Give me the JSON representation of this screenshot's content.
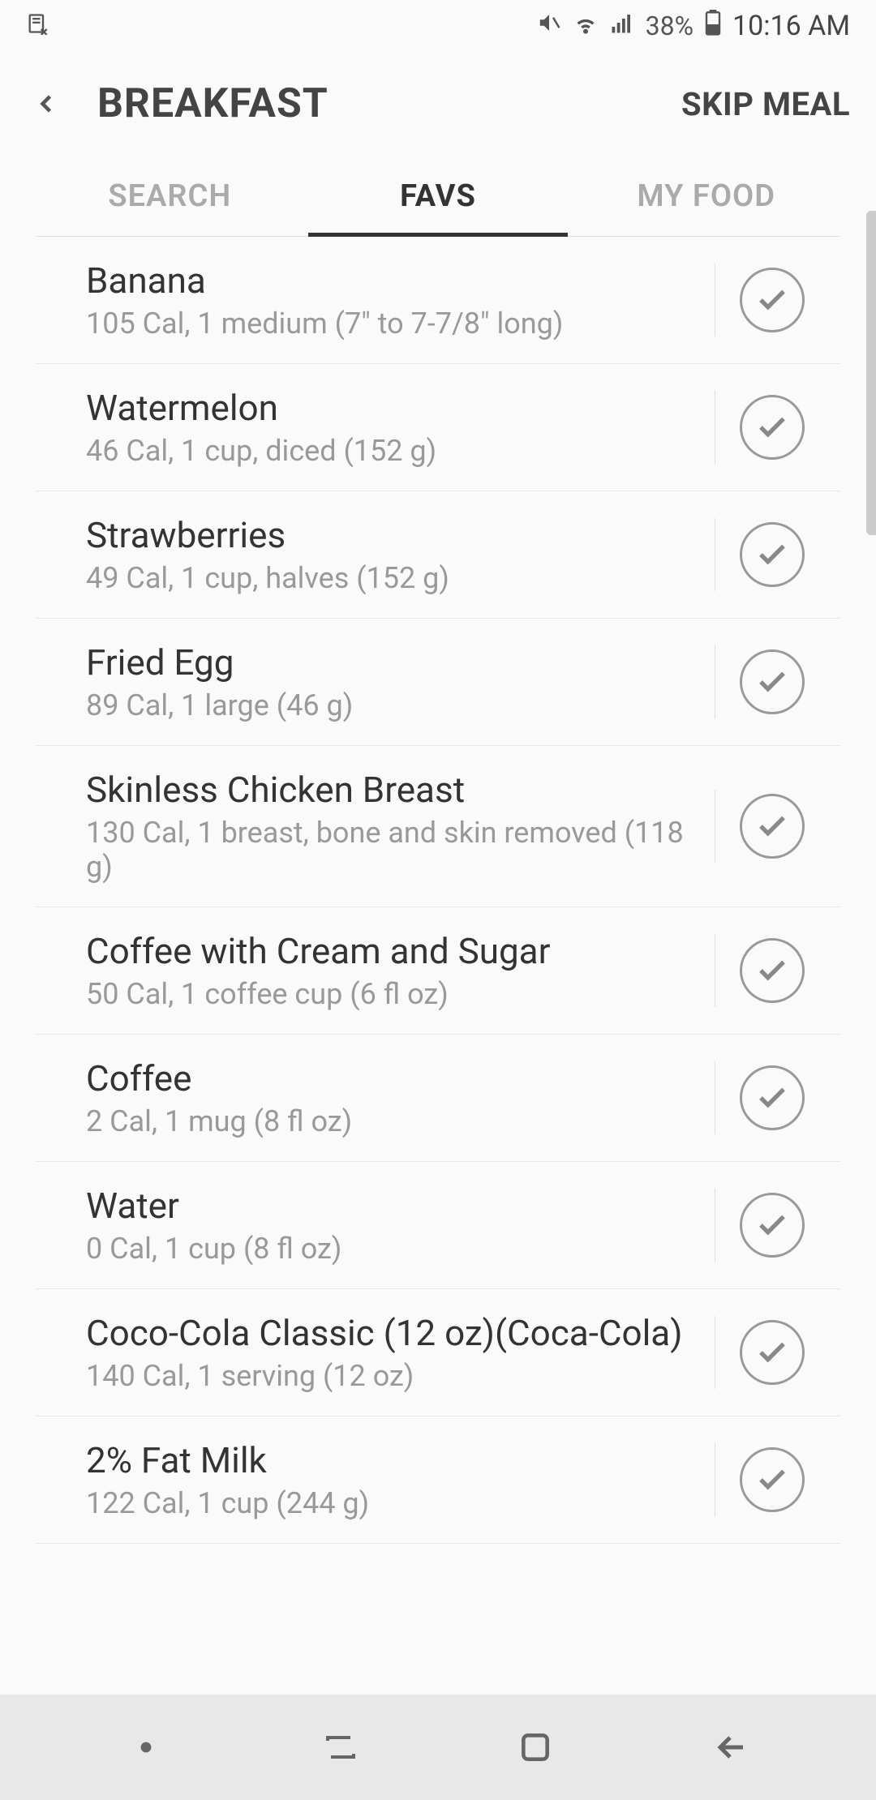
{
  "status": {
    "battery": "38%",
    "time": "10:16 AM"
  },
  "header": {
    "title": "BREAKFAST",
    "skip_label": "SKIP MEAL"
  },
  "tabs": {
    "search": "SEARCH",
    "favs": "FAVS",
    "myfood": "MY FOOD"
  },
  "foods": [
    {
      "name": "Banana",
      "details": "105 Cal, 1 medium (7\" to 7-7/8\" long)"
    },
    {
      "name": "Watermelon",
      "details": "46 Cal, 1 cup, diced (152 g)"
    },
    {
      "name": "Strawberries",
      "details": "49 Cal, 1 cup, halves (152 g)"
    },
    {
      "name": "Fried Egg",
      "details": "89 Cal, 1 large (46 g)"
    },
    {
      "name": "Skinless Chicken Breast",
      "details": "130 Cal, 1 breast, bone and skin removed (118 g)"
    },
    {
      "name": "Coffee with Cream and Sugar",
      "details": "50 Cal, 1 coffee cup (6 fl oz)"
    },
    {
      "name": "Coffee",
      "details": "2 Cal, 1 mug (8 fl oz)"
    },
    {
      "name": "Water",
      "details": "0 Cal, 1 cup (8 fl oz)"
    },
    {
      "name": "Coco-Cola Classic (12 oz)(Coca-Cola)",
      "details": "140 Cal, 1 serving (12 oz)"
    },
    {
      "name": "2% Fat Milk",
      "details": "122 Cal, 1 cup (244 g)"
    }
  ]
}
